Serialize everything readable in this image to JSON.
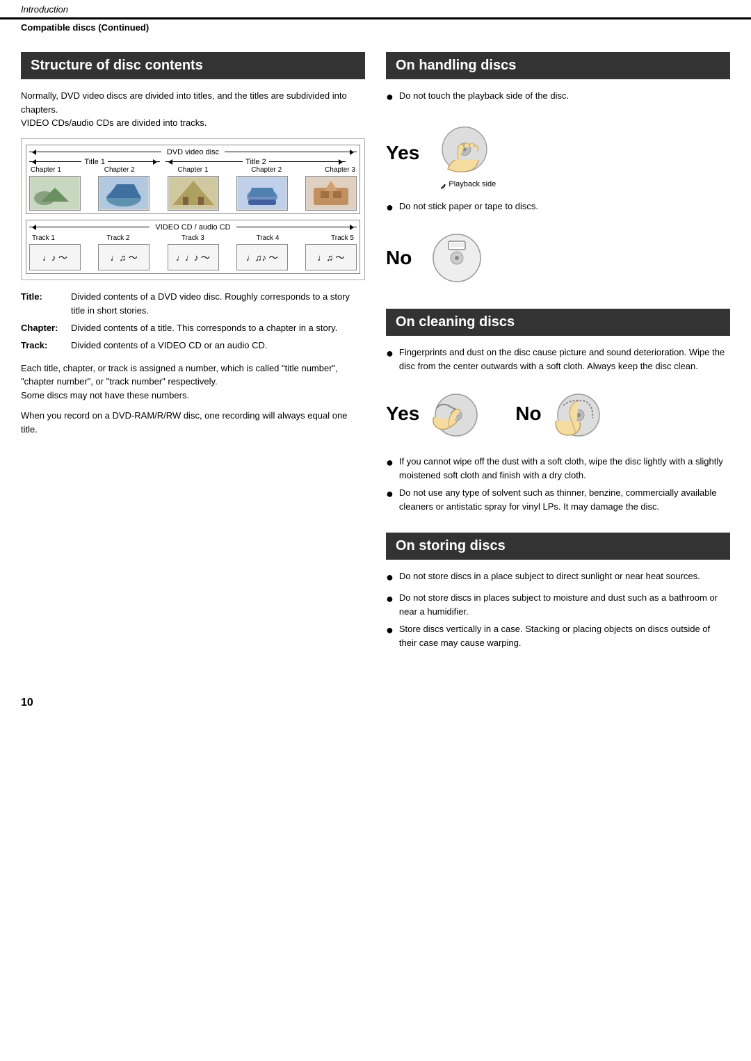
{
  "header": {
    "top_label": "Introduction",
    "sub_label": "Compatible discs (Continued)"
  },
  "left": {
    "section_title": "Structure of disc contents",
    "intro": "Normally, DVD video discs are divided into titles, and the titles are subdivided into chapters.\nVIDEO CDs/audio CDs are divided into tracks.",
    "dvd_label": "DVD video disc",
    "title1_label": "Title 1",
    "title2_label": "Title 2",
    "chapters_dvd": [
      "Chapter 1",
      "Chapter 2",
      "Chapter 1",
      "Chapter 2",
      "Chapter 3"
    ],
    "vcd_label": "VIDEO CD / audio CD",
    "tracks": [
      "Track 1",
      "Track 2",
      "Track 3",
      "Track 4",
      "Track 5"
    ],
    "track_symbols": [
      "♩♪ ～",
      "♩♫ ～",
      "♩♩♪ ～",
      "♩♫♪ ～",
      "♩♫ ～"
    ],
    "definitions": [
      {
        "term": "Title:",
        "desc": "Divided contents of a DVD video disc. Roughly corresponds to a story title in short stories."
      },
      {
        "term": "Chapter:",
        "desc": "Divided contents of a title. This corresponds to a chapter in a story."
      },
      {
        "term": "Track:",
        "desc": "Divided contents of a VIDEO CD or an audio CD."
      }
    ],
    "body1": "Each title, chapter, or track is assigned a number, which is called \"title number\", \"chapter number\", or \"track number\" respectively.\nSome discs may not have these numbers.",
    "body2": "When you record on a DVD-RAM/R/RW disc, one recording will always equal one title."
  },
  "right": {
    "handling": {
      "title": "On handling discs",
      "bullet1": "Do not touch the playback side of the disc.",
      "yes_label": "Yes",
      "playback_side_label": "Playback side",
      "bullet2": "Do not stick paper or tape to discs.",
      "no_label": "No"
    },
    "cleaning": {
      "title": "On cleaning discs",
      "bullet1": "Fingerprints and dust on the disc cause picture and sound deterioration. Wipe the disc from the center outwards with a soft cloth. Always keep the disc clean.",
      "yes_label": "Yes",
      "no_label": "No",
      "bullet2": "If you cannot wipe off the dust with a soft cloth, wipe the disc lightly with a slightly moistened soft cloth and finish with a dry cloth.",
      "bullet3": "Do not use any type of solvent such as thinner, benzine, commercially available cleaners or antistatic spray for vinyl LPs. It may damage the disc."
    },
    "storing": {
      "title": "On storing discs",
      "bullet1": "Do not store discs in a place subject to direct sunlight or near heat sources.",
      "bullet2": "Do not store discs in places subject to moisture and dust such as a bathroom or near a humidifier.",
      "bullet3": "Store discs vertically in a case. Stacking or placing objects on discs outside of their case may cause warping."
    }
  },
  "page_number": "10"
}
